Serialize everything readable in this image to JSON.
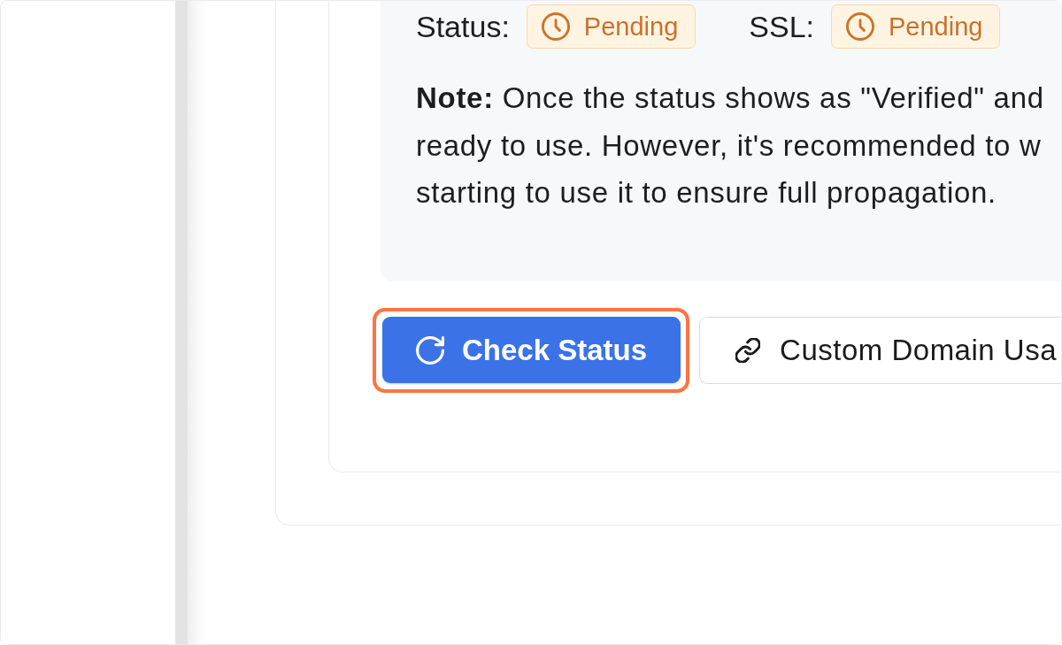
{
  "status_panel": {
    "fields": [
      {
        "label": "Status:",
        "value": "Pending"
      },
      {
        "label": "SSL:",
        "value": "Pending"
      }
    ],
    "note": {
      "lines": [
        "**Note:** Once the status shows as \"Verified\" and",
        "ready to use. However, it's recommended to w",
        "starting to use it to ensure full propagation."
      ]
    }
  },
  "actions": [
    {
      "label": "Check Status",
      "kind": "primary",
      "highlighted": true
    },
    {
      "label": "Custom Domain Usa",
      "kind": "secondary",
      "highlighted": false
    }
  ]
}
